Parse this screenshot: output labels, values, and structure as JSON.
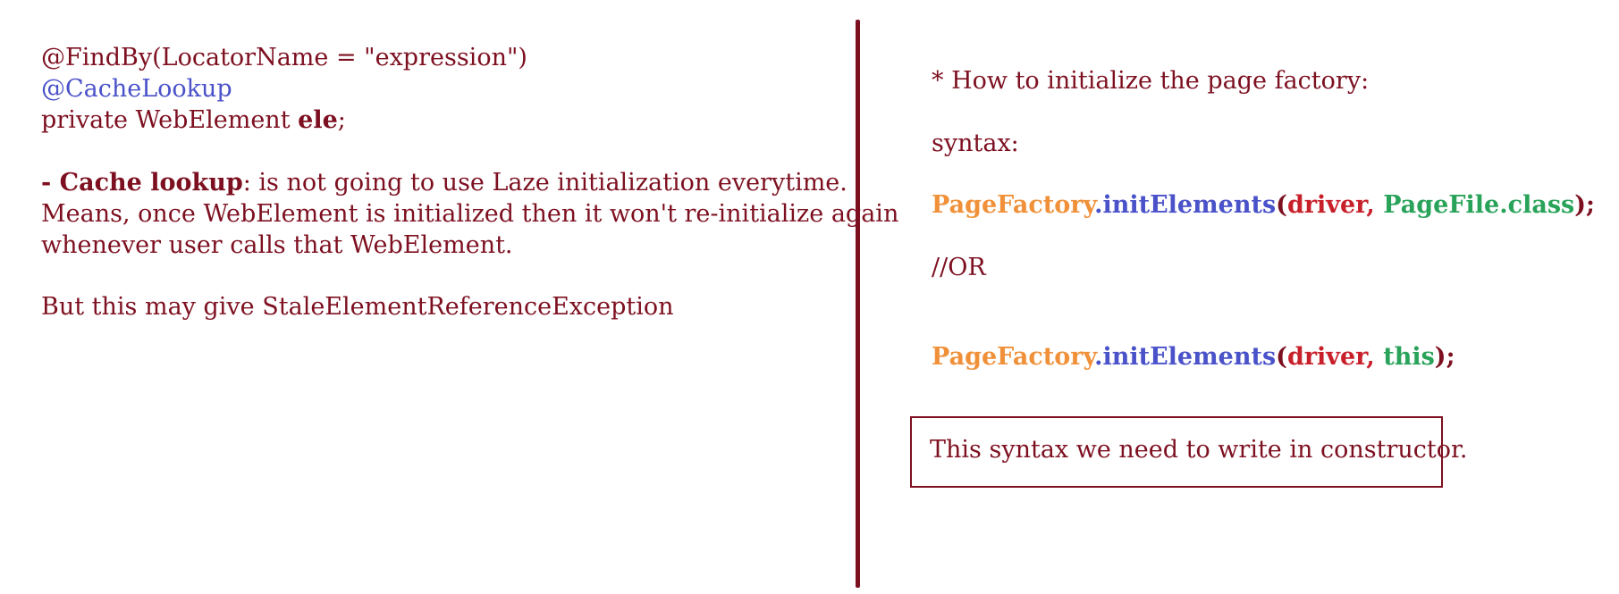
{
  "colors": {
    "maroon": "#7d1020",
    "blue": "#4a52c9",
    "orange": "#f0913a",
    "red": "#c8202a",
    "green": "#2aa35a"
  },
  "left": {
    "annotation_findby": "@FindBy(LocatorName = \"expression\")",
    "annotation_cachelookup": "@CacheLookup",
    "field_prefix": "private WebElement ",
    "field_name": "ele",
    "field_suffix": ";",
    "cache_term": "- Cache lookup",
    "cache_desc_1": ": is not going to use Laze initialization everytime.",
    "cache_desc_2": "Means, once WebElement is initialized then it won't re-initialize again",
    "cache_desc_3": "whenever user calls that WebElement.",
    "warning": "But this may give StaleElementReferenceException"
  },
  "right": {
    "heading": "* How to initialize the page factory:",
    "syntax_label": "syntax:",
    "code1": {
      "class": "PageFactory",
      "dot": ".",
      "method": "initElements",
      "open": "(",
      "arg1": "driver,",
      "arg2": "PageFile.class",
      "close": ");"
    },
    "or_label": "//OR",
    "code2": {
      "class": "PageFactory",
      "dot": ".",
      "method": "initElements",
      "open": "(",
      "arg1": "driver,",
      "arg2": "this",
      "close": ");"
    },
    "note": "This syntax we need to write in constructor."
  }
}
